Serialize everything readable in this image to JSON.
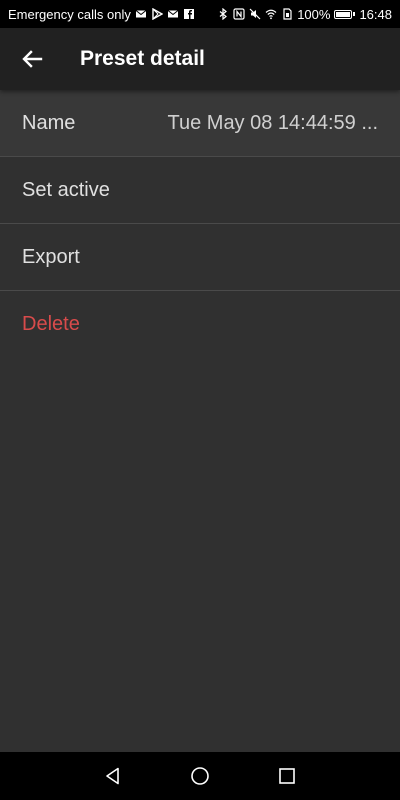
{
  "status_bar": {
    "carrier_text": "Emergency calls only",
    "battery_percent": "100%",
    "battery_level": 1.0,
    "time": "16:48",
    "left_icons": [
      "mail-icon",
      "play-store-icon",
      "mail-icon",
      "facebook-icon"
    ],
    "right_icons": [
      "bluetooth-icon",
      "nfc-icon",
      "mute-icon",
      "wifi-icon",
      "sim-icon"
    ]
  },
  "app_bar": {
    "title": "Preset detail"
  },
  "rows": {
    "name_label": "Name",
    "name_value": "Tue May 08 14:44:59 ...",
    "set_active_label": "Set active",
    "export_label": "Export",
    "delete_label": "Delete"
  },
  "colors": {
    "background": "#303030",
    "app_bar": "#212121",
    "delete_red": "#d84b4b",
    "text": "#e0e0e0"
  },
  "nav_bar": {
    "buttons": [
      "back-triangle-icon",
      "home-circle-icon",
      "recents-square-icon"
    ]
  }
}
